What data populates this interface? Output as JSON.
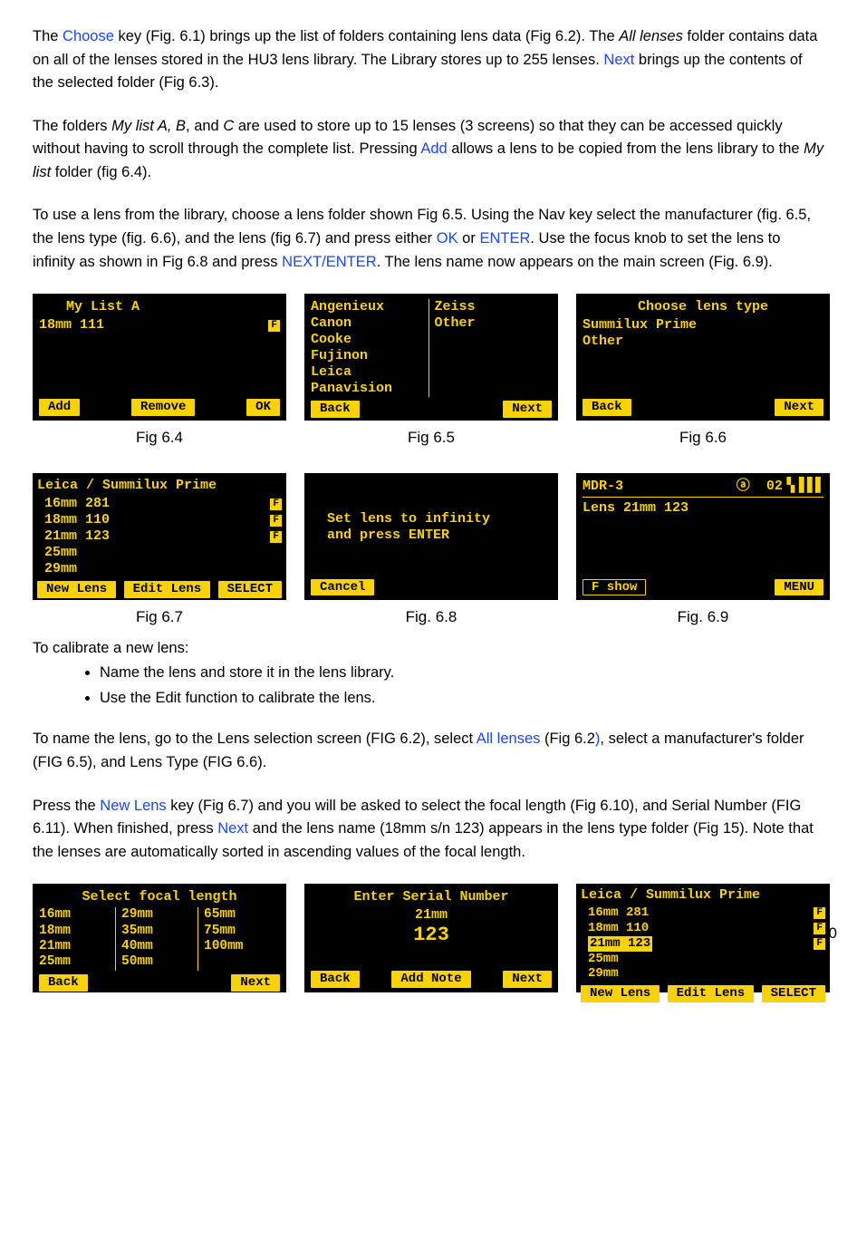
{
  "para1": {
    "t1": "The ",
    "choose": "Choose",
    "t2": " key (Fig. 6.1) brings up the list of folders containing lens data (Fig 6.2). The ",
    "alllenses": "All lenses",
    "t3": " folder contains data on all of the lenses stored in the HU3 lens library. The Library stores up to 255 lenses. ",
    "next": "Next",
    "t4": " brings up the contents of the selected folder (Fig 6.3)."
  },
  "para2": {
    "t1": "The folders ",
    "mylistab": "My list A, B",
    "t2": ", and ",
    "c": "C",
    "t3": " are used to store up to 15 lenses (3 screens) so that they can be accessed quickly without having to scroll through the complete list. Pressing ",
    "add": "Add",
    "t4": " allows a lens to be copied from the lens library to the ",
    "mylist": "My list",
    "t5": "  folder (fig 6.4)."
  },
  "para3": {
    "t1": "To use a lens from the library, choose a lens folder shown Fig 6.5. Using the Nav key select the manufacturer (fig. 6.5, the lens type (fig. 6.6), and the lens (fig 6.7) and press either ",
    "ok": "OK",
    "t2": " or ",
    "enter": "ENTER",
    "t3": ". Use the focus knob to set the lens to infinity as shown in Fig 6.8 and press ",
    "nextenter": "NEXT/ENTER",
    "t4": ". The lens name now appears on the main screen (Fig. 6.9)."
  },
  "figcaptions": {
    "f64": "Fig 6.4",
    "f65": "Fig 6.5",
    "f66": "Fig 6.6",
    "f67": "Fig 6.7",
    "f68": "Fig. 6.8",
    "f69": "Fig. 6.9"
  },
  "fig64": {
    "title": "My List A",
    "line1": "18mm 111",
    "badge": "F",
    "btnAdd": "Add",
    "btnRemove": "Remove",
    "btnOK": "OK"
  },
  "fig65": {
    "col1": [
      "Angenieux",
      "Canon",
      "Cooke",
      "Fujinon",
      "Leica",
      "Panavision"
    ],
    "col2": [
      "Zeiss",
      "Other"
    ],
    "btnBack": "Back",
    "btnNext": "Next"
  },
  "fig66": {
    "title": "Choose lens type",
    "lines": [
      "Summilux Prime",
      "Other"
    ],
    "btnBack": "Back",
    "btnNext": "Next"
  },
  "fig67": {
    "title": "Leica / Summilux Prime",
    "items": [
      {
        "txt": "16mm 281",
        "f": true
      },
      {
        "txt": "18mm 110",
        "f": true
      },
      {
        "txt": "21mm 123",
        "f": true
      },
      {
        "txt": "25mm",
        "f": false
      },
      {
        "txt": "29mm",
        "f": false
      }
    ],
    "btnNew": "New Lens",
    "btnEdit": "Edit Lens",
    "btnSelect": "SELECT"
  },
  "fig68": {
    "line1": "Set lens to infinity",
    "line2": "and press ENTER",
    "btnCancel": "Cancel"
  },
  "fig69": {
    "topLeft": "MDR-3",
    "topMid": "ⓐ",
    "topRight": "02▝▖▋▋▋",
    "lens": "Lens  21mm 123",
    "btnFshow": "F show",
    "btnMenu": "MENU"
  },
  "calibrateHeading": "To calibrate a new lens:",
  "calibrateBullets": [
    "Name the lens and store it in the lens library.",
    "Use the Edit function to calibrate the lens."
  ],
  "para4": {
    "t1": "To name the lens, go to the Lens selection screen (FIG 6.2), select ",
    "alllenses": "All lenses",
    "t2": " (Fig 6.2",
    "paren": ")",
    "t3": ", select a manufacturer's folder (FIG 6.5), and Lens Type (FIG 6.6)."
  },
  "para5": {
    "t1": "Press the ",
    "newlens": "New Lens",
    "t2": " key (Fig 6.7) and you will be asked to select the focal length (Fig 6.10), and Serial Number (FIG 6.11).  When finished, press ",
    "next": "Next",
    "t3": " and the lens name (18mm s/n 123) appears in the lens type folder (Fig 15). Note that the lenses are automatically sorted in ascending values of the focal length."
  },
  "fig610": {
    "title": "Select focal length",
    "col1": [
      "16mm",
      "18mm",
      "21mm",
      "25mm"
    ],
    "col2": [
      "29mm",
      "35mm",
      "40mm",
      "50mm"
    ],
    "col3": [
      "65mm",
      "75mm",
      "100mm"
    ],
    "btnBack": "Back",
    "btnNext": "Next"
  },
  "fig611": {
    "title": "Enter Serial Number",
    "sub": "21mm",
    "value": "123",
    "btnBack": "Back",
    "btnAddNote": "Add Note",
    "btnNext": "Next"
  },
  "fig612": {
    "title": "Leica / Summilux Prime",
    "items": [
      {
        "txt": "16mm 281",
        "f": true
      },
      {
        "txt": "18mm 110",
        "f": true
      },
      {
        "txt": "21mm 123",
        "f": true
      },
      {
        "txt": "25mm",
        "f": false
      },
      {
        "txt": "29mm",
        "f": false
      }
    ],
    "btnNew": "New Lens",
    "btnEdit": "Edit Lens",
    "btnSelect": "SELECT"
  },
  "pagenum": "0"
}
